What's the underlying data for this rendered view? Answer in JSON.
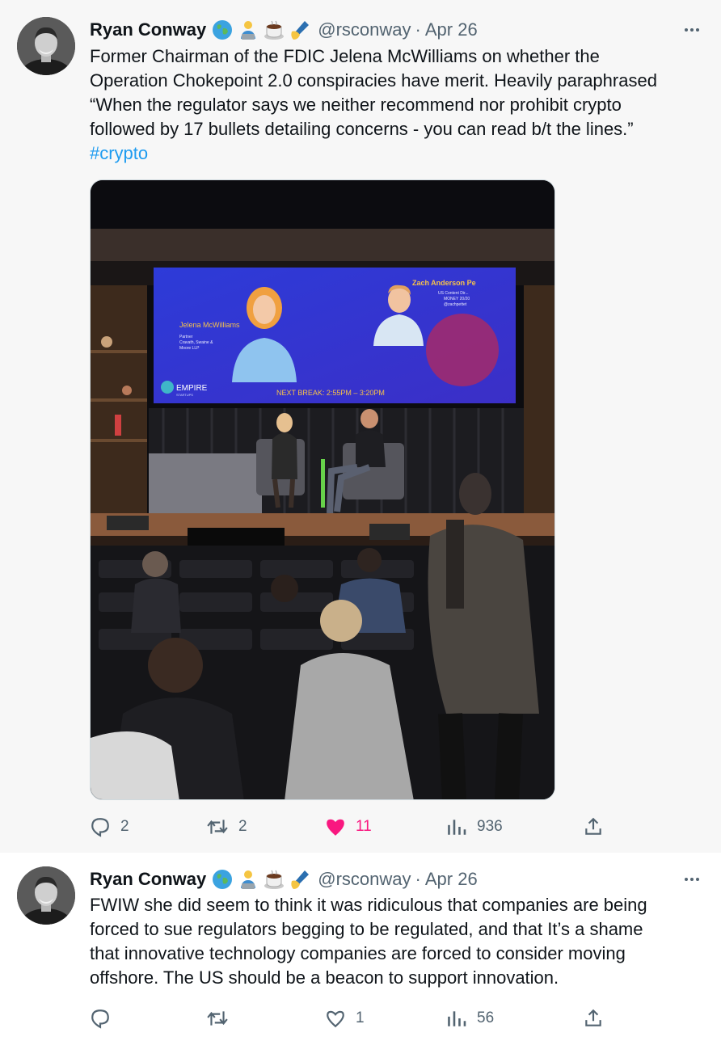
{
  "thread": [
    {
      "author": {
        "name": "Ryan Conway",
        "handle": "@rsconway",
        "emoji_icons": [
          "globe-icon",
          "person-laptop-icon",
          "coffee-icon",
          "writing-hand-icon"
        ]
      },
      "separator": "·",
      "date": "Apr 26",
      "text_lines": [
        "Former Chairman of the FDIC Jelena McWilliams on whether the",
        "Operation Chokepoint 2.0 conspiracies have merit. Heavily paraphrased",
        "“When the regulator says we neither recommend nor prohibit crypto",
        "followed by 17 bullets detailing concerns - you can read b/t the lines.”"
      ],
      "hashtag": "#crypto",
      "media": {
        "screen_left_name": "Jelena McWilliams",
        "screen_left_title_lines": [
          "Partner",
          "Cravath, Swaine &",
          "Moore LLP"
        ],
        "screen_right_name": "Zach Anderson Pe",
        "screen_right_title_lines": [
          "US Content Dir...",
          "MONEY 20/20",
          "@zachpettet"
        ],
        "screen_brand": "EMPIRE",
        "screen_brand_sub": "STARTUPS",
        "screen_break": "NEXT BREAK: 2:55PM – 3:20PM"
      },
      "stats": {
        "replies": "2",
        "retweets": "2",
        "likes": "11",
        "views": "936"
      },
      "liked": true
    },
    {
      "author": {
        "name": "Ryan Conway",
        "handle": "@rsconway",
        "emoji_icons": [
          "globe-icon",
          "person-laptop-icon",
          "coffee-icon",
          "writing-hand-icon"
        ]
      },
      "separator": "·",
      "date": "Apr 26",
      "text_lines": [
        "FWIW she did seem to think it was ridiculous that companies are being",
        "forced to sue regulators begging to be regulated, and that It’s a shame",
        "that innovative technology companies are forced to consider moving",
        "offshore. The US should be a beacon to support innovation."
      ],
      "stats": {
        "replies": "",
        "retweets": "",
        "likes": "1",
        "views": "56"
      },
      "liked": false
    }
  ],
  "colors": {
    "accent": "#1d9bf0",
    "like": "#f91880",
    "muted": "#536471",
    "text": "#0f1419",
    "thread_line": "#cfd9de"
  }
}
